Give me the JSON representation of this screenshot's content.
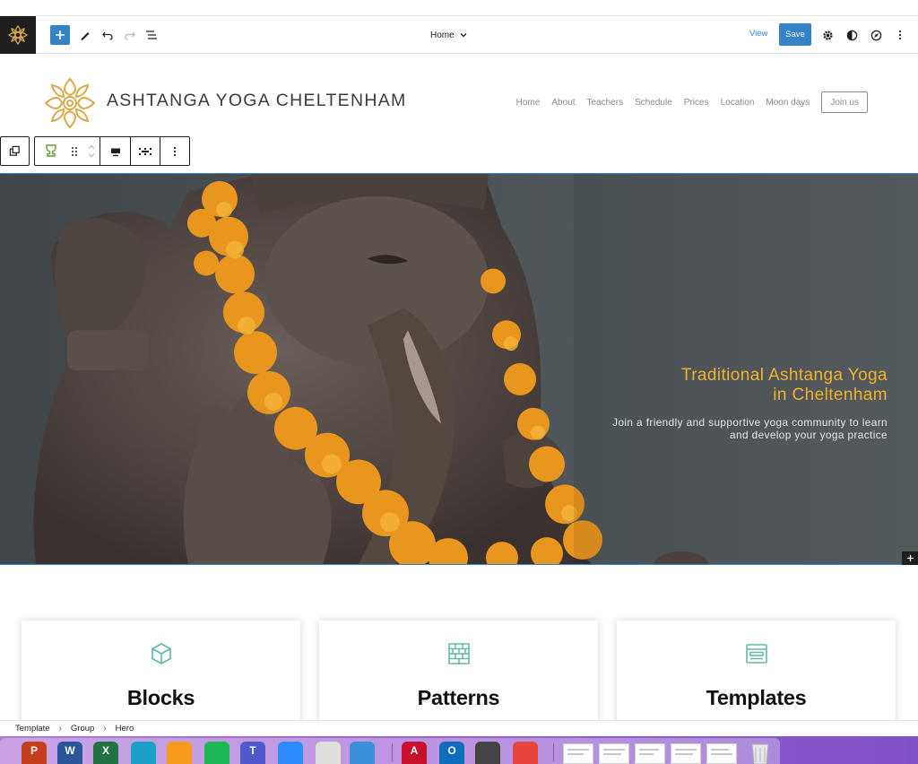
{
  "editor_toolbar": {
    "document_title": "Home",
    "view_label": "View",
    "save_label": "Save",
    "icons": [
      "plus-icon",
      "pencil-icon",
      "undo-icon",
      "redo-icon",
      "list-view-icon",
      "chevron-down-icon",
      "gear-icon",
      "contrast-icon",
      "compass-icon",
      "more-vertical-icon"
    ]
  },
  "site": {
    "title": "ASHTANGA YOGA CHELTENHAM",
    "logo_color": "#d9a94a",
    "nav": [
      "Home",
      "About",
      "Teachers",
      "Schedule",
      "Prices",
      "Location",
      "Moon days"
    ],
    "join_label": "Join us"
  },
  "block_toolbar": {
    "icons": [
      "duplicate-icon",
      "block-type-icon",
      "drag-handle-icon",
      "move-up-icon",
      "move-down-icon",
      "align-icon",
      "full-width-icon",
      "more-vertical-icon"
    ]
  },
  "hero": {
    "heading_line1": "Traditional Ashtanga Yoga",
    "heading_line2": "in Cheltenham",
    "sub_line1": "Join a friendly and supportive yoga community to learn",
    "sub_line2": "and develop your yoga practice",
    "heading_color": "#f0b229"
  },
  "cards": [
    {
      "title": "Blocks",
      "icon": "cube-icon"
    },
    {
      "title": "Patterns",
      "icon": "brick-pattern-icon"
    },
    {
      "title": "Templates",
      "icon": "template-layout-icon"
    }
  ],
  "breadcrumb": [
    "Template",
    "Group",
    "Hero"
  ],
  "dock": {
    "apps": [
      "PowerPoint",
      "Word",
      "Excel",
      "Preview",
      "Books",
      "Spotify",
      "Teams",
      "Zoom",
      "Roblox",
      "Roblox Studio",
      "Acrobat",
      "Outlook",
      "Script Editor",
      "Chrome"
    ],
    "app_colors": [
      "#c43e1c",
      "#2b579a",
      "#217346",
      "#1aa0c8",
      "#f79a1d",
      "#1db954",
      "#5059c9",
      "#2d8cff",
      "#dedede",
      "#3a8fd6",
      "#c8102e",
      "#0f6cbd",
      "#444444",
      "#e8453c"
    ],
    "app_letters": [
      "P",
      "W",
      "X",
      "",
      "",
      "",
      "T",
      "",
      "",
      "",
      "A",
      "O",
      "",
      ""
    ],
    "accent": "#9c63d2"
  }
}
